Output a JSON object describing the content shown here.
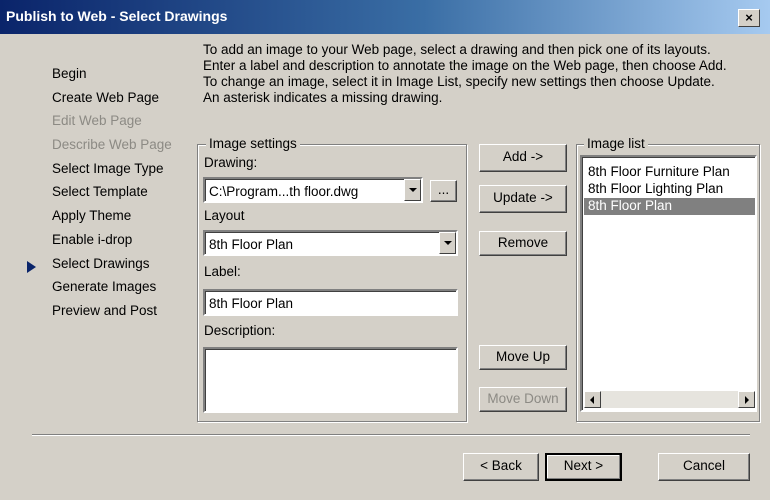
{
  "window": {
    "title": "Publish to Web - Select Drawings",
    "close_label": "×"
  },
  "nav": {
    "items": [
      {
        "label": "Begin",
        "disabled": false
      },
      {
        "label": "Create Web Page",
        "disabled": false
      },
      {
        "label": "Edit Web Page",
        "disabled": true
      },
      {
        "label": "Describe Web Page",
        "disabled": true
      },
      {
        "label": "Select Image Type",
        "disabled": false
      },
      {
        "label": "Select Template",
        "disabled": false
      },
      {
        "label": "Apply Theme",
        "disabled": false
      },
      {
        "label": "Enable i-drop",
        "disabled": false
      },
      {
        "label": "Select Drawings",
        "disabled": false,
        "current": true
      },
      {
        "label": "Generate Images",
        "disabled": false
      },
      {
        "label": "Preview and Post",
        "disabled": false
      }
    ]
  },
  "instructions": [
    "To add an image to your Web page, select a drawing and then pick one of its layouts.",
    "Enter a label and description to annotate the image on the Web page, then choose Add.",
    "To change an image, select it in Image List, specify new settings then choose Update.",
    "An asterisk indicates a missing drawing."
  ],
  "image_settings": {
    "group_title": "Image settings",
    "drawing_label": "Drawing:",
    "drawing_value": "C:\\Program...th floor.dwg",
    "browse_label": "...",
    "layout_label": "Layout",
    "layout_value": "8th Floor Plan",
    "label_label": "Label:",
    "label_value": "8th Floor Plan",
    "description_label": "Description:",
    "description_value": ""
  },
  "actions": {
    "add": "Add ->",
    "update": "Update ->",
    "remove": "Remove",
    "move_up": "Move Up",
    "move_down": "Move Down"
  },
  "image_list": {
    "title": "Image list",
    "items": [
      "8th Floor Furniture Plan",
      "8th Floor Lighting Plan",
      "8th Floor Plan"
    ],
    "selected_index": 2
  },
  "footer": {
    "back": "< Back",
    "next": "Next >",
    "cancel": "Cancel"
  },
  "colors": {
    "titlebar_start": "#0a246a",
    "titlebar_end": "#a6caf0",
    "dialog_bg": "#d4d0c8",
    "selection": "#808080",
    "disabled_text": "#8c8a84"
  }
}
